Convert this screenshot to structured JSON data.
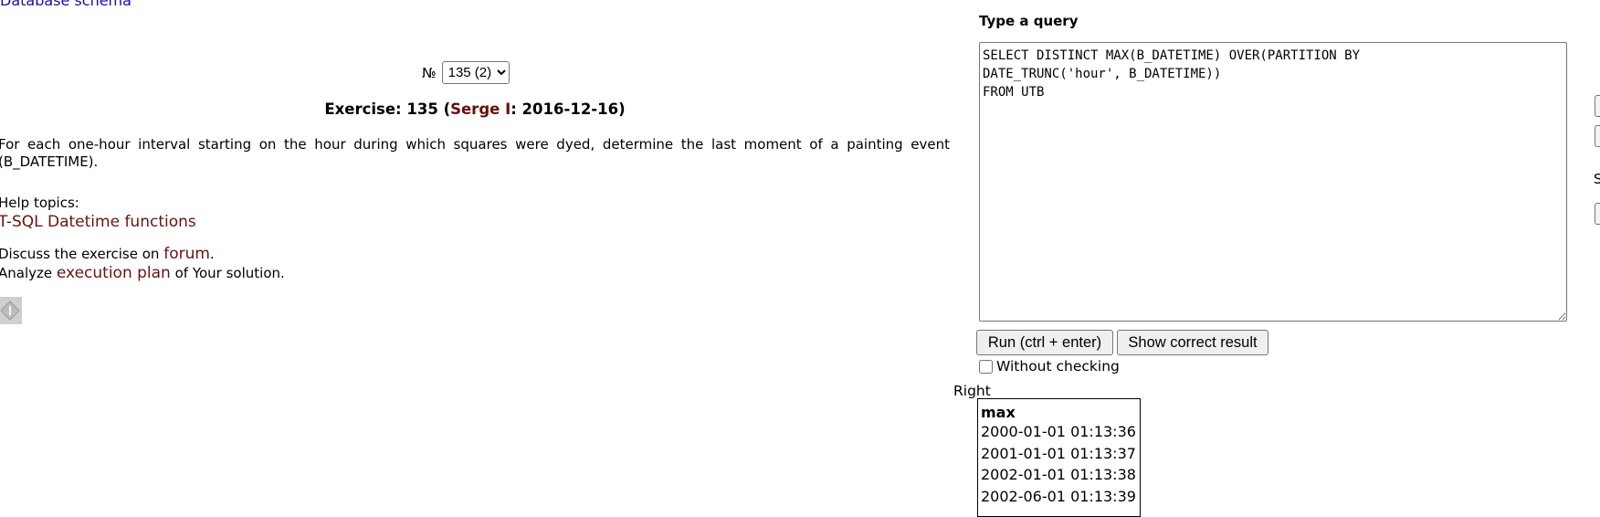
{
  "top_link": "Database schema",
  "exercise": {
    "number_label": "№",
    "selected": "135 (2)",
    "title_prefix": "Exercise: 135 (",
    "author": "Serge I",
    "title_suffix": ": 2016-12-16)",
    "description": "For each one-hour interval starting on the hour during which squares were dyed, determine the last moment of a painting event (B_DATETIME).",
    "help_label": "Help topics:",
    "help_link": "T-SQL Datetime functions",
    "discuss_prefix": "Discuss the exercise on ",
    "forum_link": "forum",
    "discuss_suffix": ".",
    "analyze_prefix": "Analyze ",
    "plan_link": "execution plan",
    "analyze_suffix": " of Your solution.",
    "info_icon": "info-diamond-icon"
  },
  "query": {
    "label": "Type a query",
    "text": "SELECT DISTINCT MAX(B_DATETIME) OVER(PARTITION BY\nDATE_TRUNC('hour', B_DATETIME))\nFROM UTB"
  },
  "buttons": {
    "run": "Run (ctrl + enter)",
    "show": "Show correct result"
  },
  "without_checking": "Without checking",
  "result": {
    "label": "Right",
    "header": "max",
    "rows": [
      "2000-01-01 01:13:36",
      "2001-01-01 01:13:37",
      "2002-01-01 01:13:38",
      "2002-06-01 01:13:39"
    ]
  },
  "edge_letter": "S"
}
